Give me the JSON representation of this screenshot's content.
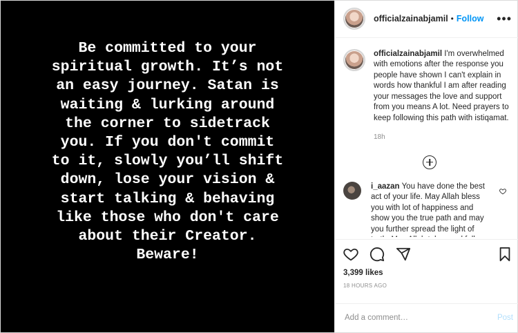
{
  "media": {
    "text": "Be committed to your\nspiritual growth. It’s not\nan easy journey. Satan is\nwaiting & lurking around\nthe corner to sidetrack\nyou. If you don't commit\nto it, slowly you’ll shift\ndown, lose your vision &\nstart talking & behaving\nlike those who don't care\nabout their Creator.\nBeware!"
  },
  "header": {
    "username": "officialzainabjamil",
    "separator": "•",
    "follow_label": "Follow",
    "more_label": "•••"
  },
  "caption": {
    "username": "officialzainabjamil",
    "text": "I'm overwhelmed with emotions after the response you people have shown I can't explain in words how thankful I am after reading your messages the love and support from you means A lot. Need prayers to keep following this path with istiqamat.",
    "time": "18h"
  },
  "comments": [
    {
      "username": "i_aazan",
      "text": "You have done the best act of your life. May Allah bless you with lot of happiness and show you the true path and may you further spread the light of truth. May Allah take good full"
    }
  ],
  "actions": {
    "likes": "3,399 likes",
    "timestamp": "18 HOURS AGO"
  },
  "add_comment": {
    "placeholder": "Add a comment…",
    "post_label": "Post"
  }
}
